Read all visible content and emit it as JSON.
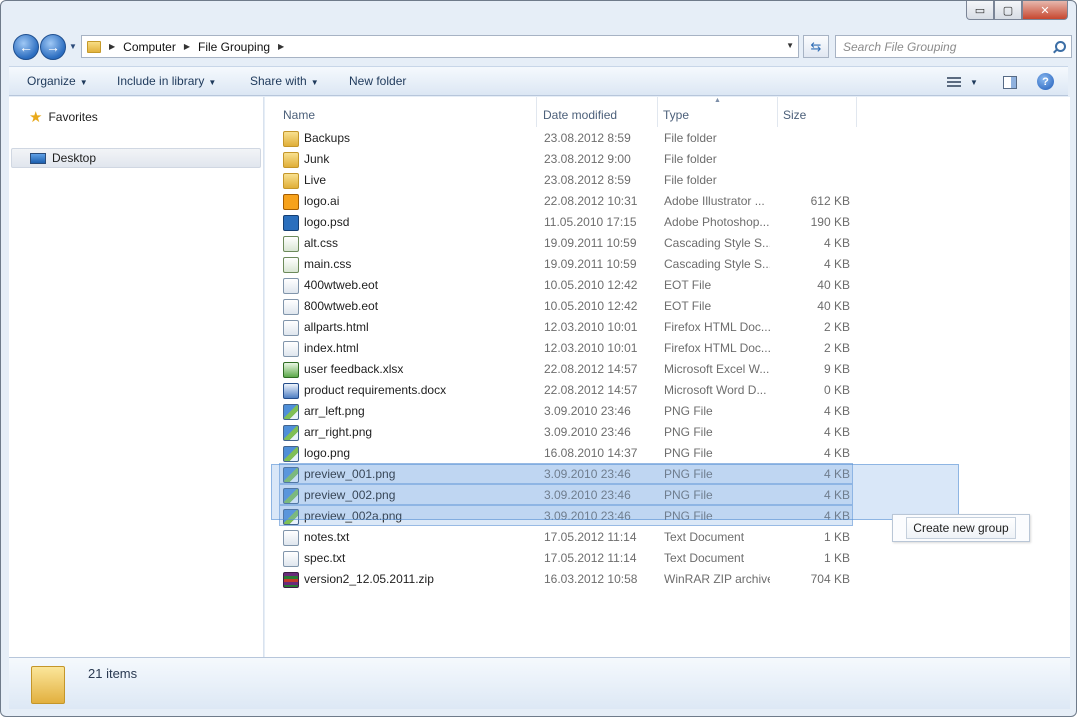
{
  "window": {
    "caption": {
      "minimize_glyph": "▭",
      "maximize_glyph": "▢",
      "close_glyph": "✕"
    }
  },
  "address_bar": {
    "breadcrumbs": [
      "Computer",
      "File Grouping"
    ],
    "search_placeholder": "Search File Grouping"
  },
  "command_bar": {
    "organize": "Organize",
    "include_in_library": "Include in library",
    "share_with": "Share with",
    "new_folder": "New folder"
  },
  "nav_pane": {
    "favorites": "Favorites",
    "desktop": "Desktop"
  },
  "columns": {
    "name": "Name",
    "date_modified": "Date modified",
    "type": "Type",
    "size": "Size"
  },
  "files": [
    {
      "name": "Backups",
      "date": "23.08.2012 8:59",
      "type": "File folder",
      "size": "",
      "icon": "folder-icon"
    },
    {
      "name": "Junk",
      "date": "23.08.2012 9:00",
      "type": "File folder",
      "size": "",
      "icon": "folder-icon"
    },
    {
      "name": "Live",
      "date": "23.08.2012 8:59",
      "type": "File folder",
      "size": "",
      "icon": "folder-icon"
    },
    {
      "name": "logo.ai",
      "date": "22.08.2012 10:31",
      "type": "Adobe Illustrator ...",
      "size": "612 KB",
      "icon": "illustrator-file-icon"
    },
    {
      "name": "logo.psd",
      "date": "11.05.2010 17:15",
      "type": "Adobe Photoshop...",
      "size": "190 KB",
      "icon": "photoshop-file-icon"
    },
    {
      "name": "alt.css",
      "date": "19.09.2011 10:59",
      "type": "Cascading Style S...",
      "size": "4 KB",
      "icon": "css-file-icon"
    },
    {
      "name": "main.css",
      "date": "19.09.2011 10:59",
      "type": "Cascading Style S...",
      "size": "4 KB",
      "icon": "css-file-icon"
    },
    {
      "name": "400wtweb.eot",
      "date": "10.05.2010 12:42",
      "type": "EOT File",
      "size": "40 KB",
      "icon": "generic-file-icon"
    },
    {
      "name": "800wtweb.eot",
      "date": "10.05.2010 12:42",
      "type": "EOT File",
      "size": "40 KB",
      "icon": "generic-file-icon"
    },
    {
      "name": "allparts.html",
      "date": "12.03.2010 10:01",
      "type": "Firefox HTML Doc...",
      "size": "2 KB",
      "icon": "generic-file-icon"
    },
    {
      "name": "index.html",
      "date": "12.03.2010 10:01",
      "type": "Firefox HTML Doc...",
      "size": "2 KB",
      "icon": "generic-file-icon"
    },
    {
      "name": "user feedback.xlsx",
      "date": "22.08.2012 14:57",
      "type": "Microsoft Excel W...",
      "size": "9 KB",
      "icon": "excel-file-icon"
    },
    {
      "name": "product requirements.docx",
      "date": "22.08.2012 14:57",
      "type": "Microsoft Word D...",
      "size": "0 KB",
      "icon": "word-file-icon"
    },
    {
      "name": "arr_left.png",
      "date": "3.09.2010 23:46",
      "type": "PNG File",
      "size": "4 KB",
      "icon": "png-file-icon"
    },
    {
      "name": "arr_right.png",
      "date": "3.09.2010 23:46",
      "type": "PNG File",
      "size": "4 KB",
      "icon": "png-file-icon"
    },
    {
      "name": "logo.png",
      "date": "16.08.2010 14:37",
      "type": "PNG File",
      "size": "4 KB",
      "icon": "png-file-icon"
    },
    {
      "name": "preview_001.png",
      "date": "3.09.2010 23:46",
      "type": "PNG File",
      "size": "4 KB",
      "icon": "png-file-icon",
      "selected": true
    },
    {
      "name": "preview_002.png",
      "date": "3.09.2010 23:46",
      "type": "PNG File",
      "size": "4 KB",
      "icon": "png-file-icon",
      "selected": true
    },
    {
      "name": "preview_002a.png",
      "date": "3.09.2010 23:46",
      "type": "PNG File",
      "size": "4 KB",
      "icon": "png-file-icon",
      "selected": true
    },
    {
      "name": "notes.txt",
      "date": "17.05.2012 11:14",
      "type": "Text Document",
      "size": "1 KB",
      "icon": "generic-file-icon"
    },
    {
      "name": "spec.txt",
      "date": "17.05.2012 11:14",
      "type": "Text Document",
      "size": "1 KB",
      "icon": "generic-file-icon"
    },
    {
      "name": "version2_12.05.2011.zip",
      "date": "16.03.2012 10:58",
      "type": "WinRAR ZIP archive",
      "size": "704 KB",
      "icon": "zip-archive-icon"
    }
  ],
  "context_action": {
    "label": "Create new group"
  },
  "details_pane": {
    "item_count": "21 items"
  },
  "colors": {
    "selection_fill": "#cfe0f5",
    "selection_border": "#6b9fdc",
    "header_text": "#4c607a",
    "secondary_text": "#6d6d6d"
  }
}
